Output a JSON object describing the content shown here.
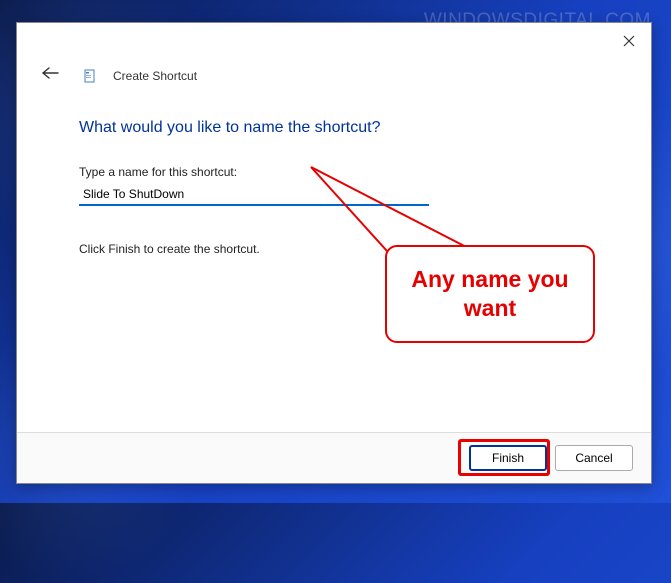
{
  "watermark": "WINDOWSDIGITAL.COM",
  "dialog": {
    "title": "Create Shortcut",
    "heading": "What would you like to name the shortcut?",
    "field_label": "Type a name for this shortcut:",
    "input_value": "Slide To ShutDown",
    "instruction": "Click Finish to create the shortcut."
  },
  "buttons": {
    "finish": "Finish",
    "cancel": "Cancel"
  },
  "annotation": {
    "callout": "Any name you want"
  }
}
